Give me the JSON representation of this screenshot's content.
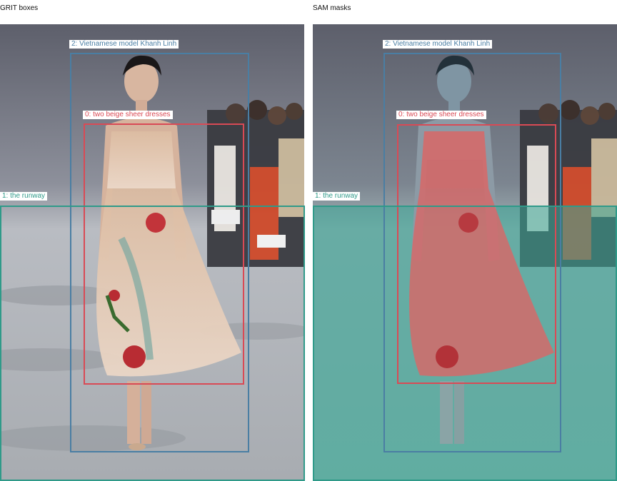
{
  "panels": {
    "left_title": "GRIT boxes",
    "right_title": "SAM masks"
  },
  "detections": [
    {
      "id": 0,
      "label": "0: two beige sheer dresses",
      "color": "#d94a55"
    },
    {
      "id": 1,
      "label": "1: the runway",
      "color": "#2f9a89"
    },
    {
      "id": 2,
      "label": "2: Vietnamese model Khanh Linh",
      "color": "#4a7ea3"
    }
  ],
  "colors": {
    "dress_box": "#d94a55",
    "runway_box": "#2f9a89",
    "model_box": "#4a7ea3",
    "dress_mask": "#d46a6a",
    "runway_mask": "#3aa898"
  }
}
